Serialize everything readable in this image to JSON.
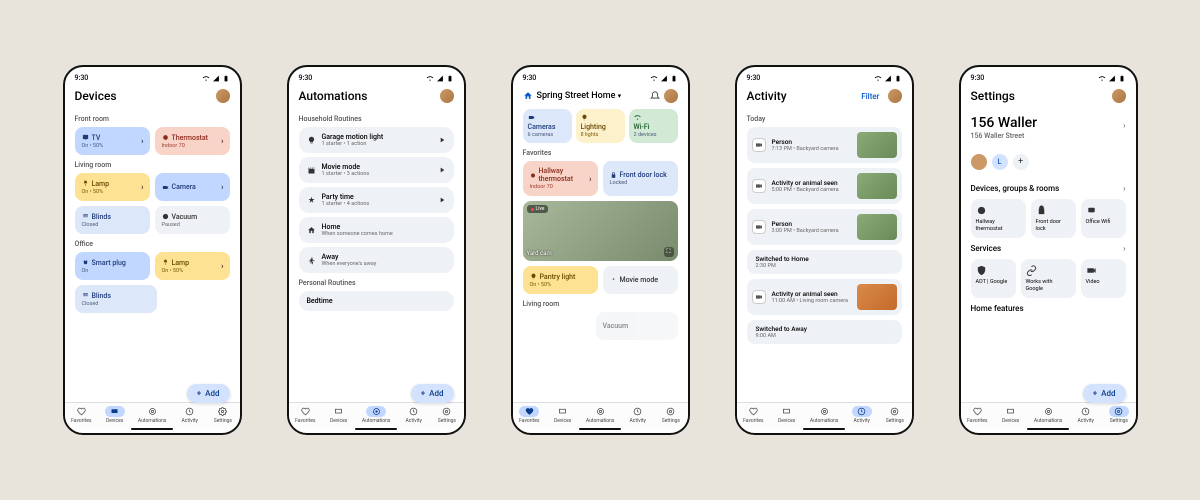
{
  "status_time": "9:30",
  "nav": [
    "Favorites",
    "Devices",
    "Automations",
    "Activity",
    "Settings"
  ],
  "fab_add": "Add",
  "p1": {
    "title": "Devices",
    "g1": "Front room",
    "t1": {
      "n": "TV",
      "s": "On • 50%"
    },
    "t2": {
      "n": "Thermostat",
      "s": "Indoor 70"
    },
    "g2": "Living room",
    "t3": {
      "n": "Lamp",
      "s": "On • 50%"
    },
    "t4": {
      "n": "Camera"
    },
    "t5": {
      "n": "Blinds",
      "s": "Closed"
    },
    "t6": {
      "n": "Vacuum",
      "s": "Paused"
    },
    "g3": "Office",
    "t7": {
      "n": "Smart plug",
      "s": "On"
    },
    "t8": {
      "n": "Lamp",
      "s": "On • 50%"
    },
    "t9": {
      "n": "Blinds",
      "s": "Closed"
    }
  },
  "p2": {
    "title": "Automations",
    "g1": "Household Routines",
    "r1": {
      "n": "Garage motion light",
      "s": "1 starter • 1 action"
    },
    "r2": {
      "n": "Movie mode",
      "s": "1 starter • 3 actions"
    },
    "r3": {
      "n": "Party time",
      "s": "1 starter • 4 actions"
    },
    "r4": {
      "n": "Home",
      "s": "When someone comes home"
    },
    "r5": {
      "n": "Away",
      "s": "When everyone's away"
    },
    "g2": "Personal Routines",
    "r6": {
      "n": "Bedtime"
    }
  },
  "p3": {
    "home": "Spring Street Home",
    "c1": {
      "n": "Cameras",
      "s": "6 cameras"
    },
    "c2": {
      "n": "Lighting",
      "s": "8 lights"
    },
    "c3": {
      "n": "Wi-Fi",
      "s": "2 devices"
    },
    "g1": "Favorites",
    "f1": {
      "n": "Hallway thermostat",
      "s": "Indoor 70"
    },
    "f2": {
      "n": "Front door lock",
      "s": "Locked"
    },
    "live": "Live",
    "cam": "Yard cam",
    "f3": {
      "n": "Pantry light",
      "s": "On • 50%"
    },
    "f4": {
      "n": "Movie mode"
    },
    "g2": "Living room",
    "f5": {
      "n": "Vacuum"
    }
  },
  "p4": {
    "title": "Activity",
    "filter": "Filter",
    "g1": "Today",
    "a1": {
      "n": "Person",
      "s": "7:13 PM • Backyard camera"
    },
    "a2": {
      "n": "Activity or animal seen",
      "s": "5:00 PM • Backyard camera"
    },
    "a3": {
      "n": "Person",
      "s": "3:00 PM • Backyard camera"
    },
    "a4": {
      "n": "Switched to Home",
      "s": "2:30 PM"
    },
    "a5": {
      "n": "Activity or animal seen",
      "s": "11:00 AM • Living room camera"
    },
    "a6": {
      "n": "Switched to Away",
      "s": "9:00 AM"
    }
  },
  "p5": {
    "title": "Settings",
    "addr": "156 Waller",
    "addr_sub": "156 Waller Street",
    "s1": "Devices, groups & rooms",
    "d1": "Hallway thermostat",
    "d2": "Front door lock",
    "d3": "Office Wifi",
    "s2": "Services",
    "v1": "ADT | Google",
    "v2": "Works with Google",
    "v3": "Video",
    "s3": "Home features"
  }
}
